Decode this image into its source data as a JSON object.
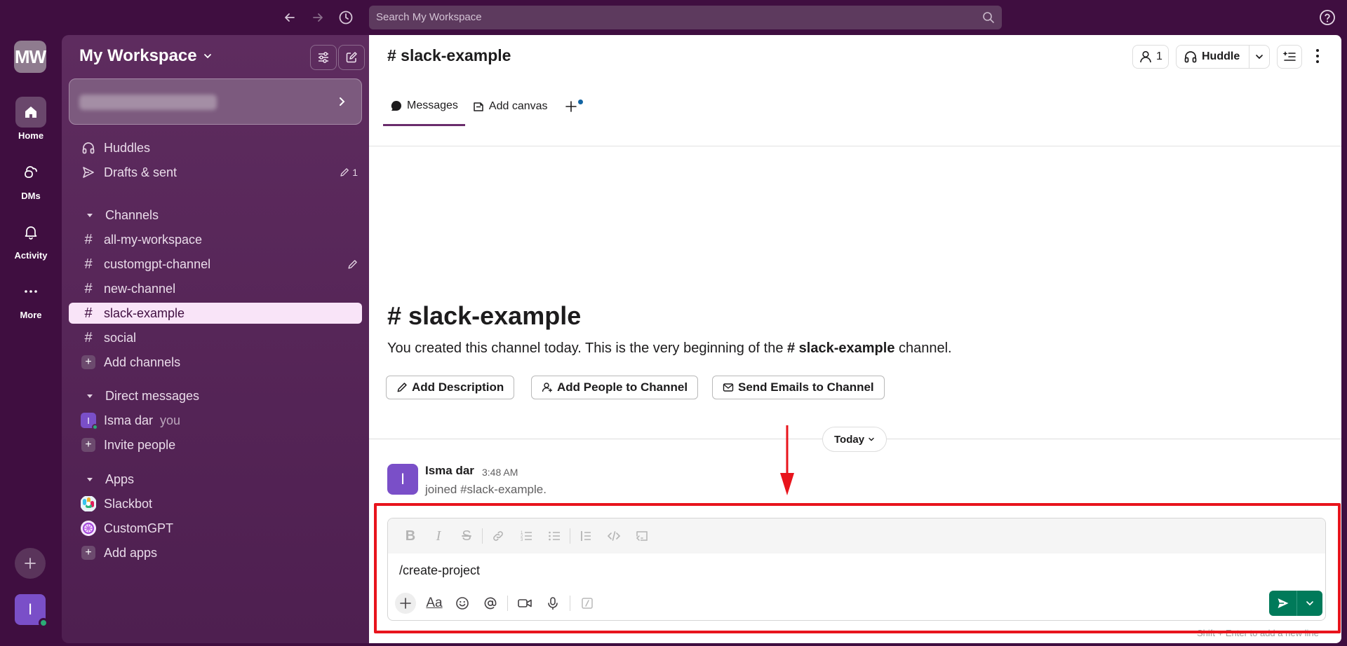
{
  "topbar": {
    "search_placeholder": "Search My Workspace"
  },
  "rail": {
    "workspace_initials": "MW",
    "items": [
      {
        "label": "Home",
        "icon": "home-icon"
      },
      {
        "label": "DMs",
        "icon": "dms-icon"
      },
      {
        "label": "Activity",
        "icon": "bell-icon"
      },
      {
        "label": "More",
        "icon": "more-icon"
      }
    ],
    "user_initial": "I"
  },
  "sidebar": {
    "workspace_name": "My Workspace",
    "top_items": [
      {
        "label": "Huddles",
        "icon": "headphones-icon"
      },
      {
        "label": "Drafts & sent",
        "icon": "send-icon",
        "count": "1"
      }
    ],
    "channels_header": "Channels",
    "channels": [
      {
        "label": "all-my-workspace"
      },
      {
        "label": "customgpt-channel"
      },
      {
        "label": "new-channel"
      },
      {
        "label": "slack-example"
      },
      {
        "label": "social"
      }
    ],
    "add_channels": "Add channels",
    "dms_header": "Direct messages",
    "dms": [
      {
        "initial": "I",
        "label": "Isma dar",
        "suffix": "you"
      }
    ],
    "invite_people": "Invite people",
    "apps_header": "Apps",
    "apps": [
      {
        "label": "Slackbot"
      },
      {
        "label": "CustomGPT"
      }
    ],
    "add_apps": "Add apps"
  },
  "channel": {
    "title": "# slack-example",
    "member_count": "1",
    "huddle_label": "Huddle",
    "tabs": [
      {
        "label": "Messages"
      },
      {
        "label": "Add canvas"
      }
    ],
    "intro_title": "slack-example",
    "intro_text_pre": "You created this channel today. This is the very beginning of the ",
    "intro_channel": "# slack-example",
    "intro_text_post": " channel.",
    "actions": [
      {
        "label": "Add Description"
      },
      {
        "label": "Add People to Channel"
      },
      {
        "label": "Send Emails to Channel"
      }
    ],
    "date_divider": "Today"
  },
  "messages": [
    {
      "initial": "I",
      "author": "Isma dar",
      "time": "3:48 AM",
      "text": "joined #slack-example."
    }
  ],
  "composer": {
    "text": "/create-project",
    "hint": "Shift + Enter to add a new line"
  },
  "colors": {
    "aubergine": "#3f0e40",
    "send_green": "#007a5a",
    "highlight_red": "#e8141c"
  }
}
